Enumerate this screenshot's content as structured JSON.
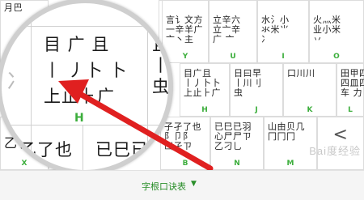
{
  "keyboard": {
    "top_row": [
      {
        "glyphs": "月巴",
        "letter": ""
      },
      {
        "glyphs": "",
        "letter": ""
      },
      {
        "glyphs": "亞亞",
        "letter": ""
      },
      {
        "glyphs": "言讠文方\n一辛羊广\n亠丶主",
        "letter": "Y"
      },
      {
        "glyphs": "立辛六\n立亠辛\n广 亠",
        "letter": "U"
      },
      {
        "glyphs": "水氵小\n氺米⺌\n冫",
        "letter": "I"
      },
      {
        "glyphs": "火灬米\n业小米\n丷",
        "letter": "O"
      }
    ],
    "middle_row": [
      {
        "glyphs": "目广且\n丨丿卜卜\n上止⺊广",
        "letter": "H"
      },
      {
        "glyphs": "日曰早\n丨川刂\n虫",
        "letter": "J"
      },
      {
        "glyphs": "口川川",
        "letter": "K"
      },
      {
        "glyphs": "田甲四\n四皿四\n车 力",
        "letter": "L"
      }
    ],
    "bottom_row": [
      {
        "glyphs": "乙了也",
        "letter": "X"
      },
      {
        "glyphs": "己巳",
        "letter": "C"
      },
      {
        "glyphs": "子孑了也\n阝卩阝\n凵孑ㄗ",
        "letter": "B"
      },
      {
        "glyphs": "已巳已羽\n心尸尸ㄗ\n乙刁乚",
        "letter": "N"
      },
      {
        "glyphs": "山由贝几\n冂冂冂",
        "letter": "M"
      }
    ],
    "side_fragment": "彡",
    "back_key": "<"
  },
  "magnifier": {
    "row1": "目 广 且",
    "row2": "丨 丿卜 卜",
    "row3": "上止⺊广",
    "letter": "H",
    "right_col": "且\n丨\n虫",
    "left_frag": "冫",
    "bottom_left": "乙了也",
    "bottom_right": "已巳已"
  },
  "footer": {
    "label": "字根口诀表",
    "caret": "▼"
  },
  "watermark": "Bai度经验",
  "colors": {
    "accent": "#3cae3c",
    "arrow": "#e02020",
    "border": "#dcdcdc"
  }
}
